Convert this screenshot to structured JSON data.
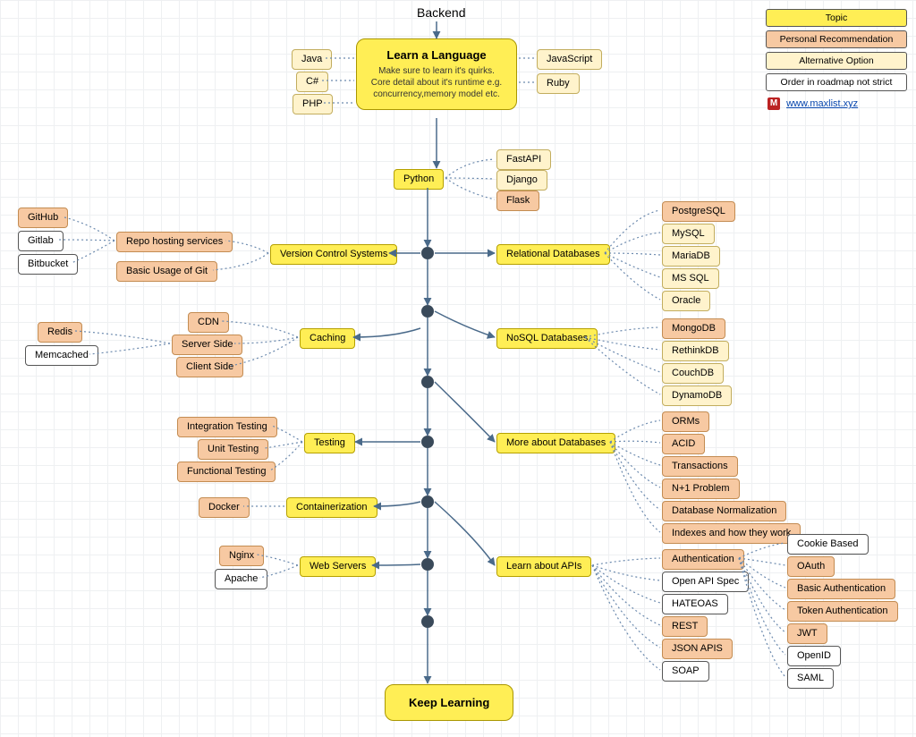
{
  "header": "Backend",
  "main": {
    "title": "Learn a Language",
    "desc": "Make sure to learn it's quirks. Core detail about it's runtime e.g. concurrency,memory model etc."
  },
  "keep": "Keep Learning",
  "legend": {
    "topic": "Topic",
    "rec": "Personal Recommendation",
    "alt": "Alternative Option",
    "plain": "Order in roadmap not strict",
    "link": "www.maxlist.xyz",
    "m": "M"
  },
  "langs_left": {
    "java": "Java",
    "csharp": "C#",
    "php": "PHP"
  },
  "langs_right": {
    "js": "JavaScript",
    "ruby": "Ruby"
  },
  "python": {
    "label": "Python",
    "fastapi": "FastAPI",
    "django": "Django",
    "flask": "Flask"
  },
  "vcs": {
    "label": "Version Control Systems",
    "repo": "Repo hosting services",
    "basic": "Basic Usage of Git",
    "github": "GitHub",
    "gitlab": "Gitlab",
    "bitbucket": "Bitbucket"
  },
  "reldb": {
    "label": "Relational Databases",
    "postgres": "PostgreSQL",
    "mysql": "MySQL",
    "mariadb": "MariaDB",
    "mssql": "MS SQL",
    "oracle": "Oracle"
  },
  "nosql": {
    "label": "NoSQL Databases",
    "mongo": "MongoDB",
    "rethink": "RethinkDB",
    "couch": "CouchDB",
    "dynamo": "DynamoDB"
  },
  "caching": {
    "label": "Caching",
    "cdn": "CDN",
    "server": "Server Side",
    "client": "Client Side",
    "redis": "Redis",
    "memcached": "Memcached"
  },
  "testing": {
    "label": "Testing",
    "integration": "Integration Testing",
    "unit": "Unit Testing",
    "functional": "Functional Testing"
  },
  "moredb": {
    "label": "More about Databases",
    "orms": "ORMs",
    "acid": "ACID",
    "trans": "Transactions",
    "n1": "N+1 Problem",
    "norm": "Database Normalization",
    "idx": "Indexes and how they work"
  },
  "container": {
    "label": "Containerization",
    "docker": "Docker"
  },
  "webservers": {
    "label": "Web Servers",
    "nginx": "Nginx",
    "apache": "Apache"
  },
  "apis": {
    "label": "Learn about APIs",
    "auth": "Authentication",
    "openapi": "Open API Spec",
    "hateoas": "HATEOAS",
    "rest": "REST",
    "jsonapis": "JSON APIS",
    "soap": "SOAP",
    "cookie": "Cookie Based",
    "oauth": "OAuth",
    "basic": "Basic Authentication",
    "token": "Token Authentication",
    "jwt": "JWT",
    "openid": "OpenID",
    "saml": "SAML"
  }
}
